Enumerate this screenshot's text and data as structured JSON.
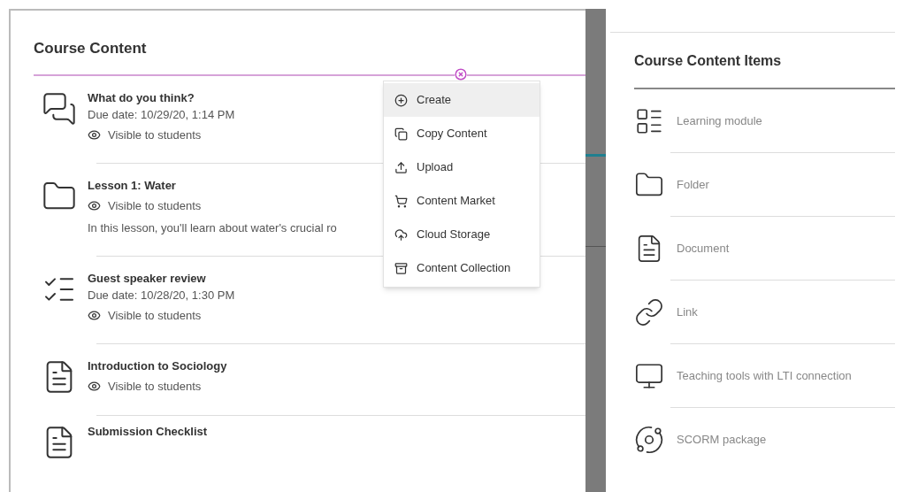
{
  "course_content": {
    "title": "Course Content",
    "items": [
      {
        "kind": "discussion",
        "title": "What do you think?",
        "due": "Due date: 10/29/20, 1:14 PM",
        "visibility": "Visible to students"
      },
      {
        "kind": "folder",
        "title": "Lesson 1: Water",
        "visibility": "Visible to students",
        "description": "In this lesson, you'll learn about water's crucial ro"
      },
      {
        "kind": "assignment",
        "title": "Guest speaker review",
        "due": "Due date: 10/28/20, 1:30 PM",
        "visibility": "Visible to students"
      },
      {
        "kind": "document",
        "title": "Introduction to Sociology",
        "visibility": "Visible to students"
      },
      {
        "kind": "document",
        "title": "Submission Checklist"
      }
    ]
  },
  "add_menu": {
    "items": [
      {
        "kind": "create",
        "label": "Create",
        "selected": true
      },
      {
        "kind": "copy",
        "label": "Copy Content",
        "selected": false
      },
      {
        "kind": "upload",
        "label": "Upload",
        "selected": false
      },
      {
        "kind": "market",
        "label": "Content Market",
        "selected": false
      },
      {
        "kind": "cloud",
        "label": "Cloud Storage",
        "selected": false
      },
      {
        "kind": "collection",
        "label": "Content Collection",
        "selected": false
      }
    ]
  },
  "items_panel": {
    "title": "Course Content Items",
    "items": [
      {
        "kind": "module",
        "label": "Learning module"
      },
      {
        "kind": "folder",
        "label": "Folder"
      },
      {
        "kind": "document",
        "label": "Document"
      },
      {
        "kind": "link",
        "label": "Link"
      },
      {
        "kind": "lti",
        "label": "Teaching tools with LTI connection"
      },
      {
        "kind": "scorm",
        "label": "SCORM package"
      }
    ]
  }
}
